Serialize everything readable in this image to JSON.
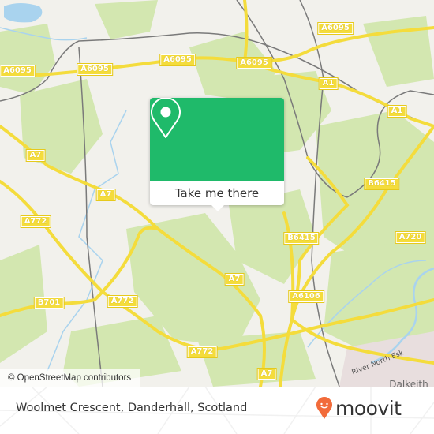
{
  "map": {
    "road_labels": [
      {
        "id": "a6095-w",
        "text": "A6095"
      },
      {
        "id": "a6095-mid",
        "text": "A6095"
      },
      {
        "id": "a6095-c",
        "text": "A6095"
      },
      {
        "id": "a6095-ne",
        "text": "A6095"
      },
      {
        "id": "a6095-e",
        "text": "A6095"
      },
      {
        "id": "a1-1",
        "text": "A1"
      },
      {
        "id": "a1-2",
        "text": "A1"
      },
      {
        "id": "a7-nw",
        "text": "A7"
      },
      {
        "id": "a7-w",
        "text": "A7"
      },
      {
        "id": "a772-w",
        "text": "A772"
      },
      {
        "id": "b6415-n",
        "text": "B6415"
      },
      {
        "id": "b6415-s",
        "text": "B6415"
      },
      {
        "id": "a720",
        "text": "A720"
      },
      {
        "id": "a7-c",
        "text": "A7"
      },
      {
        "id": "a6106",
        "text": "A6106"
      },
      {
        "id": "b701",
        "text": "B701"
      },
      {
        "id": "a772-mid",
        "text": "A772"
      },
      {
        "id": "a772-s",
        "text": "A772"
      },
      {
        "id": "a7-s",
        "text": "A7"
      }
    ],
    "place_labels": [
      {
        "id": "dalkeith",
        "text": "Dalkeith"
      }
    ],
    "river_labels": [
      {
        "id": "river-north-esk",
        "text": "River North Esk"
      }
    ],
    "attribution": "© OpenStreetMap contributors",
    "colors": {
      "land": "#f2f1ec",
      "park": "#cfe5a8",
      "road": "#f4dc3c",
      "water": "#a9d3ee",
      "rail": "#777777"
    }
  },
  "popup": {
    "icon": "location-pin-icon",
    "button_label": "Take me there",
    "accent": "#1fba6a"
  },
  "footer": {
    "location_title": "Woolmet Crescent, Danderhall, Scotland",
    "brand": "moovit",
    "brand_color": "#f26b3a"
  }
}
